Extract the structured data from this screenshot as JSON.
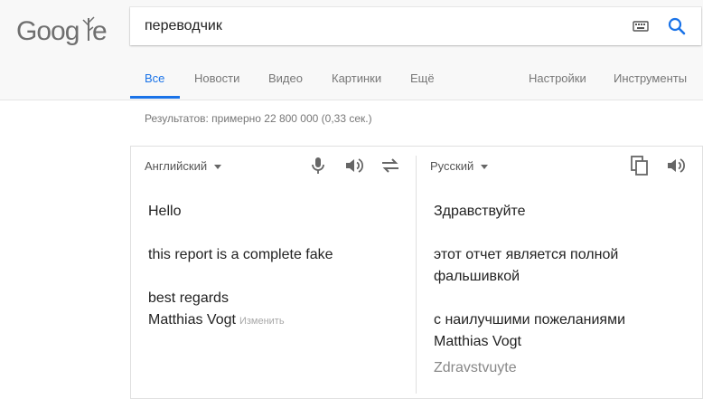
{
  "logo": {
    "text": "Google"
  },
  "search": {
    "value": "переводчик"
  },
  "tabs": [
    {
      "label": "Все"
    },
    {
      "label": "Новости"
    },
    {
      "label": "Видео"
    },
    {
      "label": "Картинки"
    },
    {
      "label": "Ещё"
    },
    {
      "label": "Настройки"
    },
    {
      "label": "Инструменты"
    }
  ],
  "results": {
    "stats": "Результатов: примерно 22 800 000 (0,33 сек.)"
  },
  "translator": {
    "source_lang": "Английский",
    "target_lang": "Русский",
    "source_lines": [
      "Hello",
      "this report is a complete fake",
      "best regards",
      "Matthias Vogt"
    ],
    "edit_label": "Изменить",
    "target_lines": [
      "Здравствуйте",
      "этот отчет является полной",
      "фальшивкой",
      "с наилучшими пожеланиями",
      "Matthias Vogt"
    ],
    "transliteration": "Zdravstvuyte"
  },
  "colors": {
    "accent": "#1a73e8",
    "icon_grey": "#666666"
  }
}
